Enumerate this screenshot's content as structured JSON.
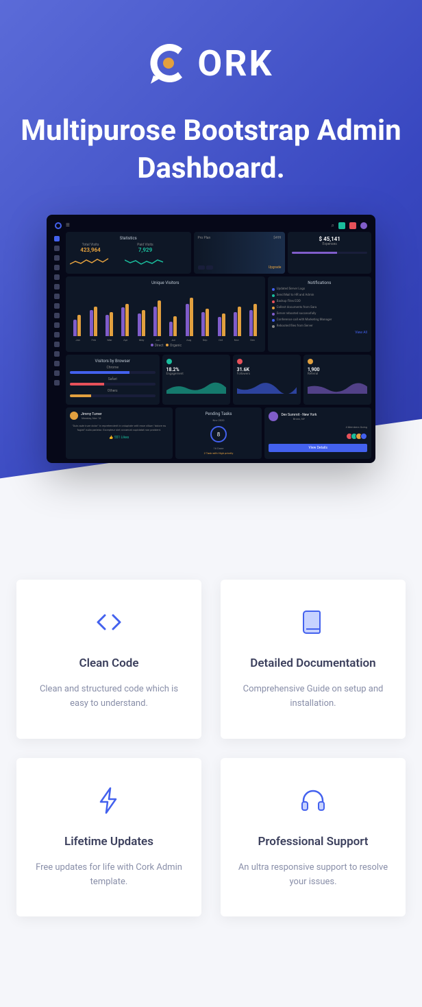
{
  "brand": {
    "name": "ORK"
  },
  "headline": "Multipurose Bootstrap Admin Dashboard.",
  "dashboard": {
    "statistics": {
      "title": "Statistics",
      "total_visits_label": "Total Visits",
      "total_visits_value": "423,964",
      "paid_visits_label": "Paid Visits",
      "paid_visits_value": "7,929"
    },
    "pro": {
      "title": "Pro Plan",
      "price": "$499",
      "upgrade": "Upgrade"
    },
    "summary": {
      "value": "$ 45,141",
      "label": "Expenses"
    },
    "chart": {
      "title": "Unique Visitors",
      "months": [
        "Jan",
        "Feb",
        "Mar",
        "Apr",
        "May",
        "Jun",
        "Jul",
        "Aug",
        "Sep",
        "Oct",
        "Nov",
        "Dec"
      ],
      "legend_direct": "Direct",
      "legend_organic": "Organic"
    },
    "notifications": {
      "title": "Notifications",
      "items": [
        "Updated Server Logs",
        "Send Mail to HR and Admin",
        "Backup Files EOD",
        "Collect documents from Sara",
        "Server rebooted successfully",
        "Conference call with Marketing Manager",
        "Rebooted files from Server"
      ],
      "view_all": "View All"
    },
    "browsers": {
      "title": "Visitors by Browser",
      "items": [
        {
          "name": "Chrome",
          "pct": 70,
          "color": "#4361ee"
        },
        {
          "name": "Safari",
          "pct": 40,
          "color": "#e7515a"
        },
        {
          "name": "Others",
          "pct": 25,
          "color": "#e2a03f"
        }
      ]
    },
    "metrics": [
      {
        "value": "18.2%",
        "label": "Engagement",
        "color": "#1abc9c"
      },
      {
        "value": "31.6K",
        "label": "Followers",
        "color": "#e7515a"
      },
      {
        "value": "1,900",
        "label": "Referral",
        "color": "#e2a03f"
      }
    ],
    "testimonial": {
      "name": "Jimmy Turner",
      "date": "Monday, Nov 18",
      "text": "\"Duis aute irure dolor\" in reprehenderit in voluptate velit esse cillum \"dolore eu fugiat\" nulla pariatur. Excepteur sint occaecat cupidatat non proident.",
      "likes": "551 Likes"
    },
    "pending": {
      "title": "Pending Tasks",
      "date": "Nov 2020",
      "count": "8",
      "completed": "16 Done",
      "priority": "2 Task with High priority"
    },
    "profile": {
      "name": "Dev Summit - New York",
      "loc": "Bronx, NY",
      "members_label": "4 Members Going",
      "button": "View Details"
    }
  },
  "features": [
    {
      "title": "Clean Code",
      "desc": "Clean and structured code which is easy to understand."
    },
    {
      "title": "Detailed Documentation",
      "desc": "Comprehensive Guide on setup and installation."
    },
    {
      "title": "Lifetime Updates",
      "desc": "Free updates for life with Cork Admin template."
    },
    {
      "title": "Professional Support",
      "desc": "An ultra responsive support to resolve your issues."
    }
  ],
  "chart_data": {
    "type": "bar",
    "title": "Unique Visitors",
    "categories": [
      "Jan",
      "Feb",
      "Mar",
      "Apr",
      "May",
      "Jun",
      "Jul",
      "Aug",
      "Sep",
      "Oct",
      "Nov",
      "Dec"
    ],
    "series": [
      {
        "name": "Direct",
        "values": [
          35,
          55,
          45,
          60,
          48,
          62,
          30,
          68,
          50,
          40,
          50,
          55
        ]
      },
      {
        "name": "Organic",
        "values": [
          45,
          62,
          50,
          68,
          55,
          75,
          42,
          80,
          58,
          48,
          62,
          68
        ]
      }
    ],
    "ylim": [
      0,
      100
    ]
  }
}
